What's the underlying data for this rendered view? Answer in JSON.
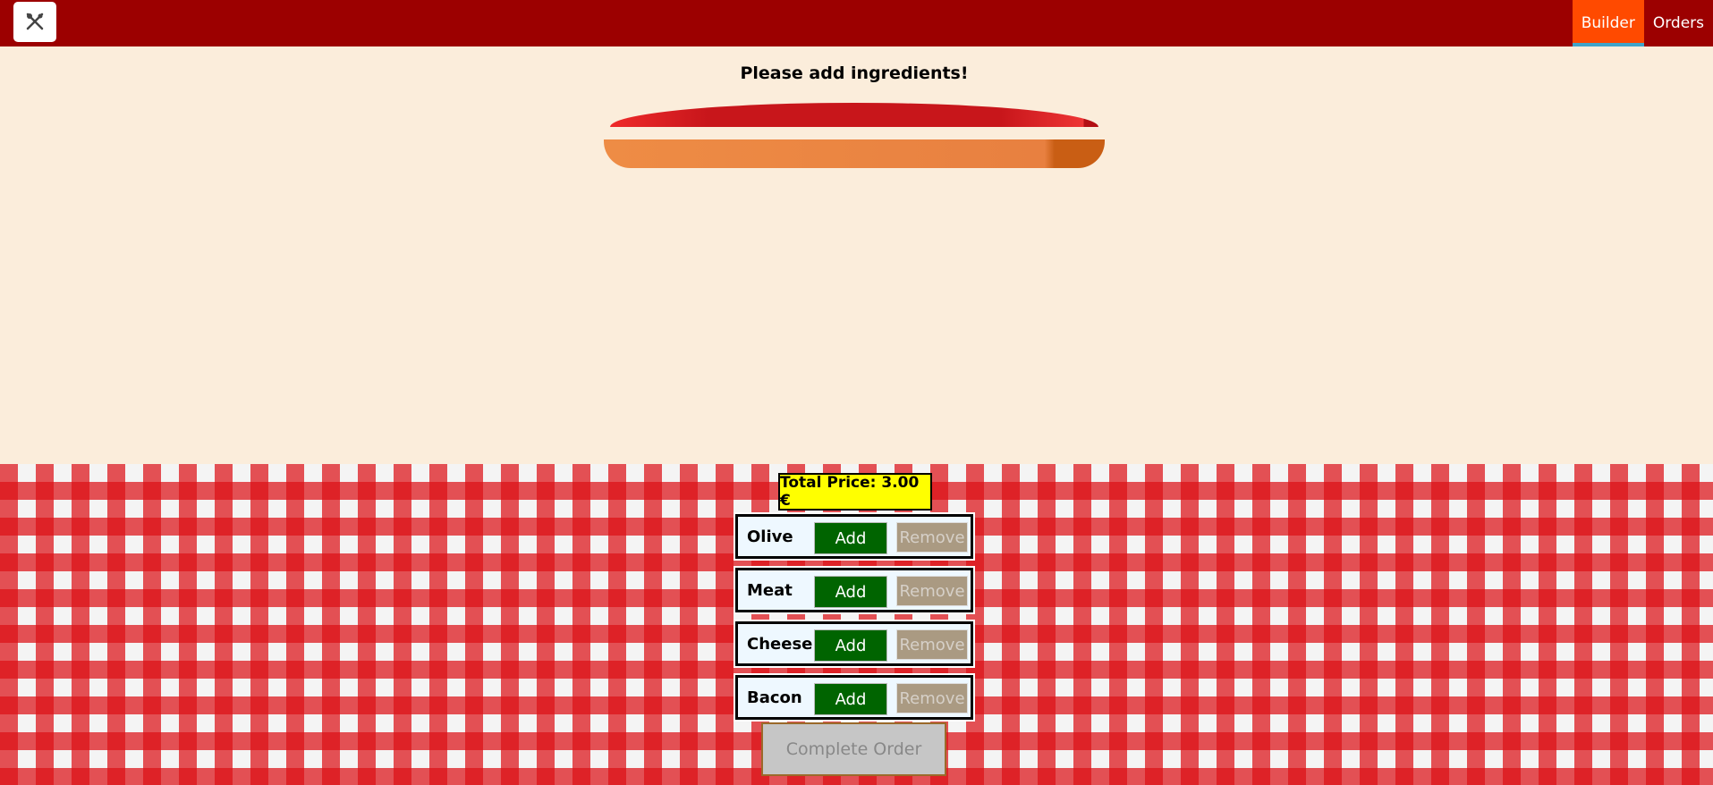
{
  "header": {
    "logo_icon": "burger-tools-icon",
    "nav": [
      {
        "label": "Builder",
        "active": true
      },
      {
        "label": "Orders",
        "active": false
      }
    ]
  },
  "builder": {
    "prompt": "Please add ingredients!"
  },
  "controls": {
    "total_price": "Total Price: 3.00 €",
    "ingredients": [
      {
        "label": "Olive",
        "add": "Add",
        "remove": "Remove"
      },
      {
        "label": "Meat",
        "add": "Add",
        "remove": "Remove"
      },
      {
        "label": "Cheese",
        "add": "Add",
        "remove": "Remove"
      },
      {
        "label": "Bacon",
        "add": "Add",
        "remove": "Remove"
      }
    ],
    "complete_order": "Complete Order"
  },
  "colors": {
    "header": "#9c0000",
    "active_nav": "#ff4a00",
    "add_button": "#006400",
    "price_badge": "#ffff00"
  }
}
